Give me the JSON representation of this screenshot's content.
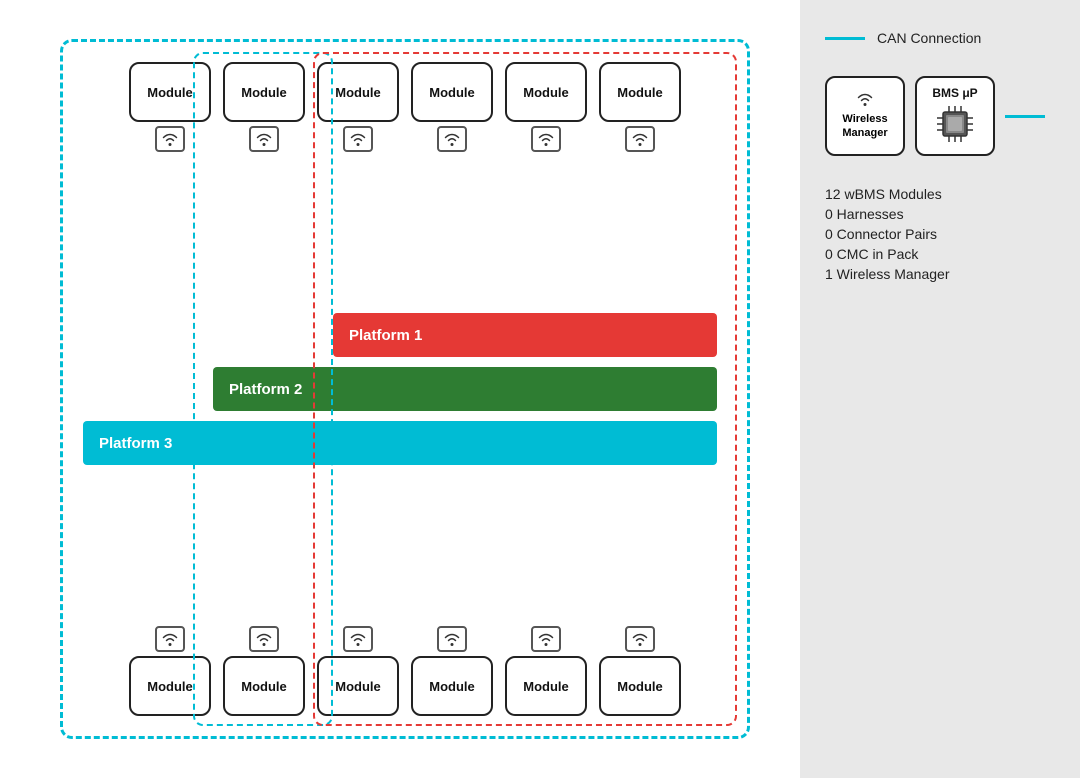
{
  "diagram": {
    "modules_top": [
      "Module",
      "Module",
      "Module",
      "Module",
      "Module",
      "Module"
    ],
    "modules_bottom": [
      "Module",
      "Module",
      "Module",
      "Module",
      "Module",
      "Module"
    ],
    "platforms": [
      {
        "label": "Platform 1",
        "color": "#e53935"
      },
      {
        "label": "Platform 2",
        "color": "#2e7d32"
      },
      {
        "label": "Platform 3",
        "color": "#00bcd4"
      }
    ]
  },
  "sidebar": {
    "legend": {
      "line_color": "#00bcd4",
      "label": "CAN Connection"
    },
    "bms": {
      "wireless_manager_label": "Wireless\nManager",
      "bms_label": "BMS μP"
    },
    "stats": [
      "12 wBMS Modules",
      "0 Harnesses",
      "0 Connector Pairs",
      "0 CMC in Pack",
      "1 Wireless Manager"
    ]
  }
}
